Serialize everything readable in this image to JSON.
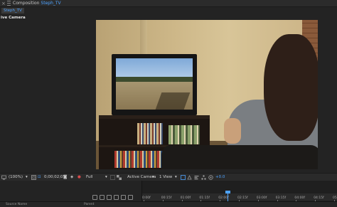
{
  "panel": {
    "title_prefix": "Composition",
    "comp_name": "Steph_TV",
    "close_glyph": "×"
  },
  "tab": {
    "label": "Steph_TV"
  },
  "viewer": {
    "camera_label": "ive Camera"
  },
  "toolbar": {
    "magnification": "(100%)",
    "timecode": "0;00;02;05",
    "resolution": "Full",
    "view": "Active Camera",
    "view_count": "1 View",
    "exposure": "+0.0"
  },
  "timeline": {
    "col_labels": [
      "Source Name",
      "Parent"
    ],
    "ruler_labels": [
      "0:00f",
      "00:15f",
      "01:00f",
      "01:15f",
      "02:00f",
      "02:15f",
      "03:00f",
      "03:15f",
      "04:00f",
      "04:15f",
      "05:00f"
    ],
    "work_area_fraction": 0.23,
    "playhead_seconds": 2.2
  },
  "colors": {
    "accent": "#4ea3ff",
    "panel_bg": "#232323",
    "toolbar_bg": "#2a2a2a"
  }
}
